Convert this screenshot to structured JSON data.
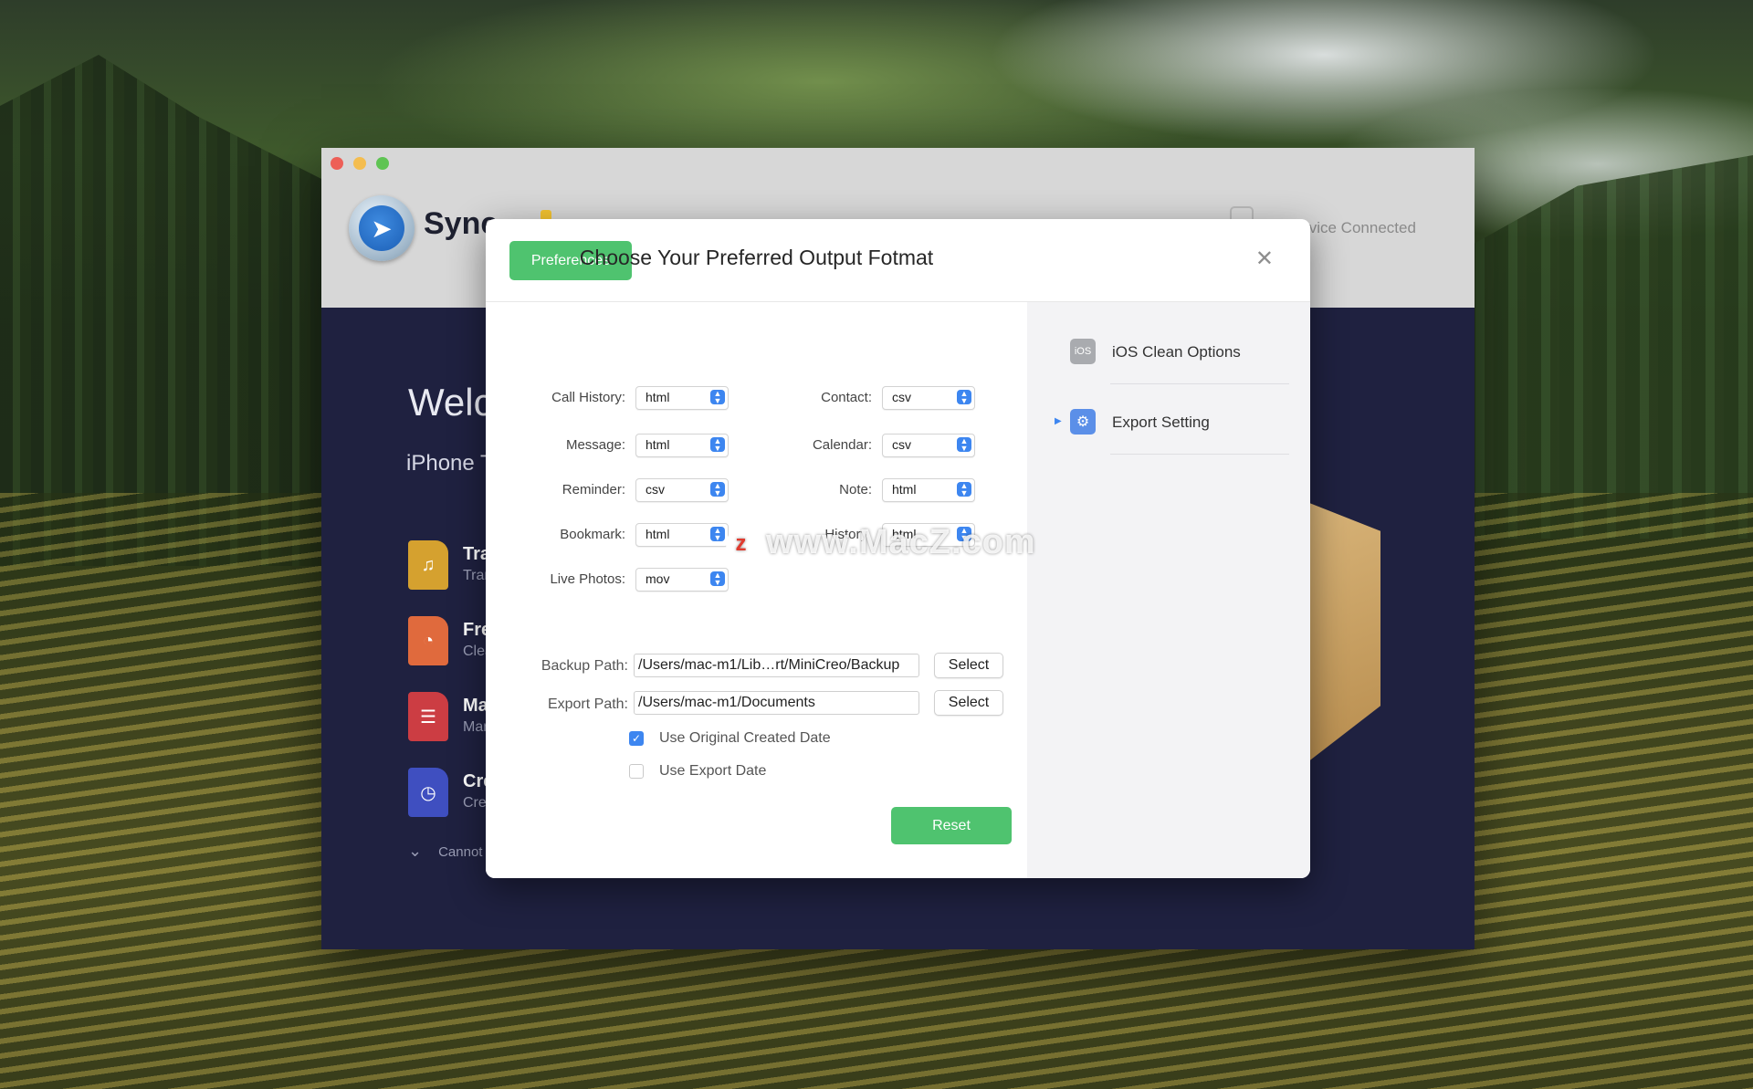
{
  "app": {
    "name": "Sync",
    "device_status": "Device Connected",
    "welcome_title": "Welc",
    "welcome_subtitle": "iPhone T",
    "features": [
      {
        "title": "Tra",
        "subtitle": "Tran",
        "icon": "music-note-icon",
        "color": "#d5a12f"
      },
      {
        "title": "Fre",
        "subtitle": "Clea",
        "icon": "pie-chart-icon",
        "color": "#e06a3d"
      },
      {
        "title": "Ma",
        "subtitle": "Mar",
        "icon": "list-icon",
        "color": "#cc3d43"
      },
      {
        "title": "Cre",
        "subtitle": "Crea",
        "icon": "clock-icon",
        "color": "#3f4fc0"
      }
    ],
    "cannot_text": "Cannot"
  },
  "dialog": {
    "tab_label": "Preferences",
    "title": "Choose Your Preferred Output Fotmat",
    "formats": {
      "call_history": {
        "label": "Call History:",
        "value": "html"
      },
      "message": {
        "label": "Message:",
        "value": "html"
      },
      "reminder": {
        "label": "Reminder:",
        "value": "csv"
      },
      "bookmark": {
        "label": "Bookmark:",
        "value": "html"
      },
      "live_photos": {
        "label": "Live Photos:",
        "value": "mov"
      },
      "contact": {
        "label": "Contact:",
        "value": "csv"
      },
      "calendar": {
        "label": "Calendar:",
        "value": "csv"
      },
      "note": {
        "label": "Note:",
        "value": "html"
      },
      "history": {
        "label": "History",
        "value": "html"
      }
    },
    "backup_path": {
      "label": "Backup Path:",
      "value": "/Users/mac-m1/Lib…rt/MiniCreo/Backup"
    },
    "export_path": {
      "label": "Export Path:",
      "value": "/Users/mac-m1/Documents"
    },
    "select_label": "Select",
    "use_original_date": {
      "label": "Use Original Created Date",
      "checked": true
    },
    "use_export_date": {
      "label": "Use Export Date",
      "checked": false
    },
    "reset_label": "Reset",
    "sidebar": [
      {
        "label": "iOS Clean Options",
        "icon": "ios-icon",
        "icon_text": "iOS"
      },
      {
        "label": "Export Setting",
        "icon": "gear-icon"
      }
    ]
  },
  "watermark": "www.MacZ.com",
  "colors": {
    "accent_green": "#4fc36f",
    "accent_blue": "#3d86f0",
    "app_bg": "#1f2140"
  }
}
